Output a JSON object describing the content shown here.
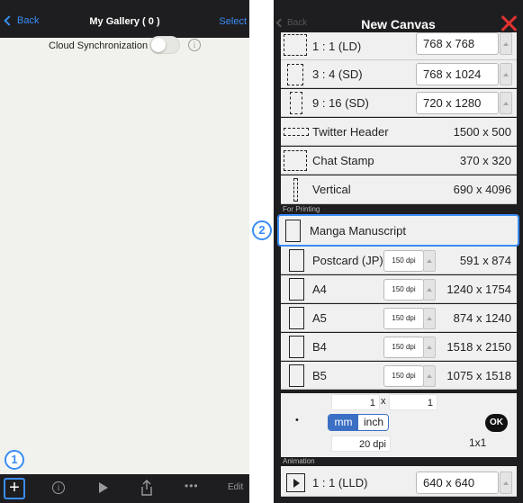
{
  "gallery": {
    "back_label": "Back",
    "title": "My Gallery ( 0 )",
    "select_label": "Select",
    "cloud_sync_label": "Cloud Synchronization",
    "cloud_sync_on": false,
    "toolbar": {
      "add_icon": "plus-icon",
      "info_icon": "info-icon",
      "play_icon": "play-icon",
      "share_icon": "share-icon",
      "more_label": "•••",
      "edit_label": "Edit"
    },
    "callout_number": "1"
  },
  "dialog": {
    "back_label": "Back",
    "title": "New Canvas",
    "close_icon": "close-icon",
    "callout_number": "2",
    "presets": [
      {
        "label": "1 : 1 (LD)",
        "size": "768 x 768"
      },
      {
        "label": "3 : 4 (SD)",
        "size": "768 x 1024"
      },
      {
        "label": "9 : 16 (SD)",
        "size": "720 x 1280"
      }
    ],
    "fixed_items": [
      {
        "label": "Twitter Header",
        "size": "1500 x 500"
      },
      {
        "label": "Chat Stamp",
        "size": "370 x 320"
      },
      {
        "label": "Vertical",
        "size": "690 x 4096"
      }
    ],
    "printing_section": "For Printing",
    "manga_label": "Manga Manuscript",
    "print_items": [
      {
        "label": "Postcard (JP)",
        "dpi": "150 dpi",
        "size": "591 x 874"
      },
      {
        "label": "A4",
        "dpi": "150 dpi",
        "size": "1240 x 1754"
      },
      {
        "label": "A5",
        "dpi": "150 dpi",
        "size": "874 x 1240"
      },
      {
        "label": "B4",
        "dpi": "150 dpi",
        "size": "1518 x 2150"
      },
      {
        "label": "B5",
        "dpi": "150 dpi",
        "size": "1075 x 1518"
      }
    ],
    "custom": {
      "width": "1",
      "times": "x",
      "height": "1",
      "bullet": "•",
      "unit_mm": "mm",
      "unit_inch": "inch",
      "selected_unit": "mm",
      "dpi": "20 dpi",
      "result": "1x1",
      "ok_label": "OK"
    },
    "animation_section": "Animation",
    "animation_item": {
      "label": "1 : 1 (LLD)",
      "size": "640 x 640"
    }
  },
  "colors": {
    "accent": "#3a8df5",
    "dark_bar": "#1e1e20",
    "close": "#e23232"
  }
}
